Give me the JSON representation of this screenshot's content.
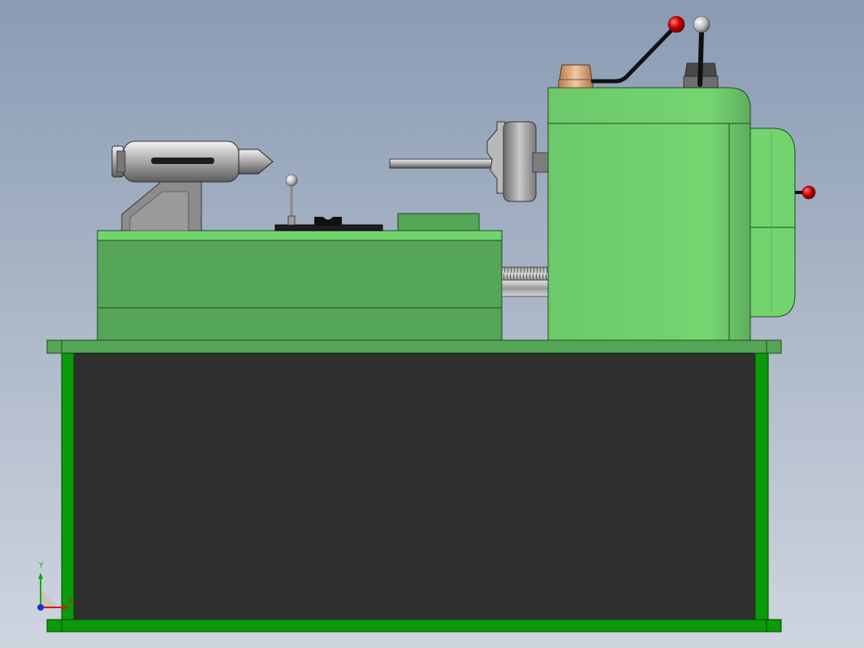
{
  "app": {
    "title": ""
  },
  "model": {
    "frame_color": "#0a9a0a",
    "body_color": "#55a657",
    "head_color": "#73d46f",
    "cabinet_color": "#2f2f2f",
    "knob_color": "#d00000"
  },
  "triad": {
    "x_label": "X",
    "y_label": "Y"
  }
}
